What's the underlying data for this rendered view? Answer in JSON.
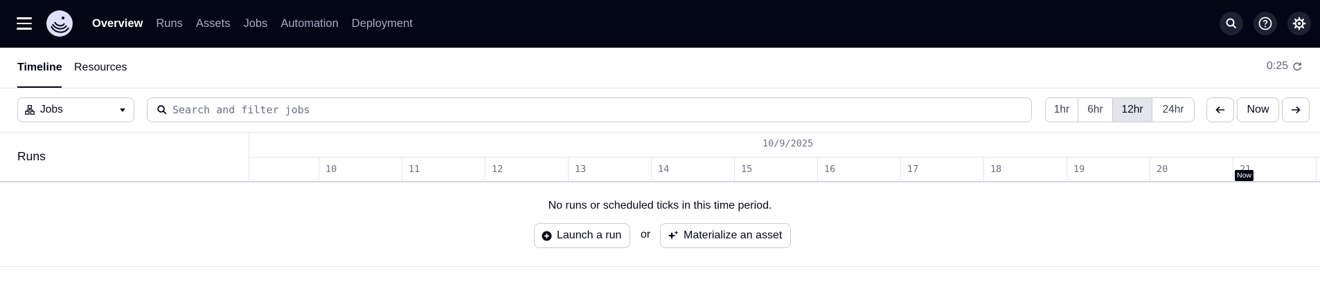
{
  "nav": {
    "links": [
      {
        "label": "Overview",
        "active": true
      },
      {
        "label": "Runs",
        "active": false
      },
      {
        "label": "Assets",
        "active": false
      },
      {
        "label": "Jobs",
        "active": false
      },
      {
        "label": "Automation",
        "active": false
      },
      {
        "label": "Deployment",
        "active": false
      }
    ],
    "icons": [
      "search-icon",
      "help-icon",
      "gear-icon"
    ]
  },
  "tabs": {
    "items": [
      {
        "label": "Timeline",
        "active": true
      },
      {
        "label": "Resources",
        "active": false
      }
    ],
    "refresh_timer": "0:25"
  },
  "toolbar": {
    "group_select": "Jobs",
    "search_placeholder": "Search and filter jobs",
    "ranges": [
      {
        "label": "1hr",
        "selected": false
      },
      {
        "label": "6hr",
        "selected": false
      },
      {
        "label": "12hr",
        "selected": true
      },
      {
        "label": "24hr",
        "selected": false
      }
    ],
    "now_label": "Now"
  },
  "timeline": {
    "runs_title": "Runs",
    "date": "10/9/2025",
    "hours": [
      "10",
      "11",
      "12",
      "13",
      "14",
      "15",
      "16",
      "17",
      "18",
      "19",
      "20",
      "21"
    ],
    "now_marker": "Now"
  },
  "empty_state": {
    "message": "No runs or scheduled ticks in this time period.",
    "launch_label": "Launch a run",
    "or_text": "or",
    "materialize_label": "Materialize an asset"
  },
  "colors": {
    "nav_bg": "#030615",
    "accent": "#030615",
    "selected_range_bg": "#e3e5ec"
  }
}
